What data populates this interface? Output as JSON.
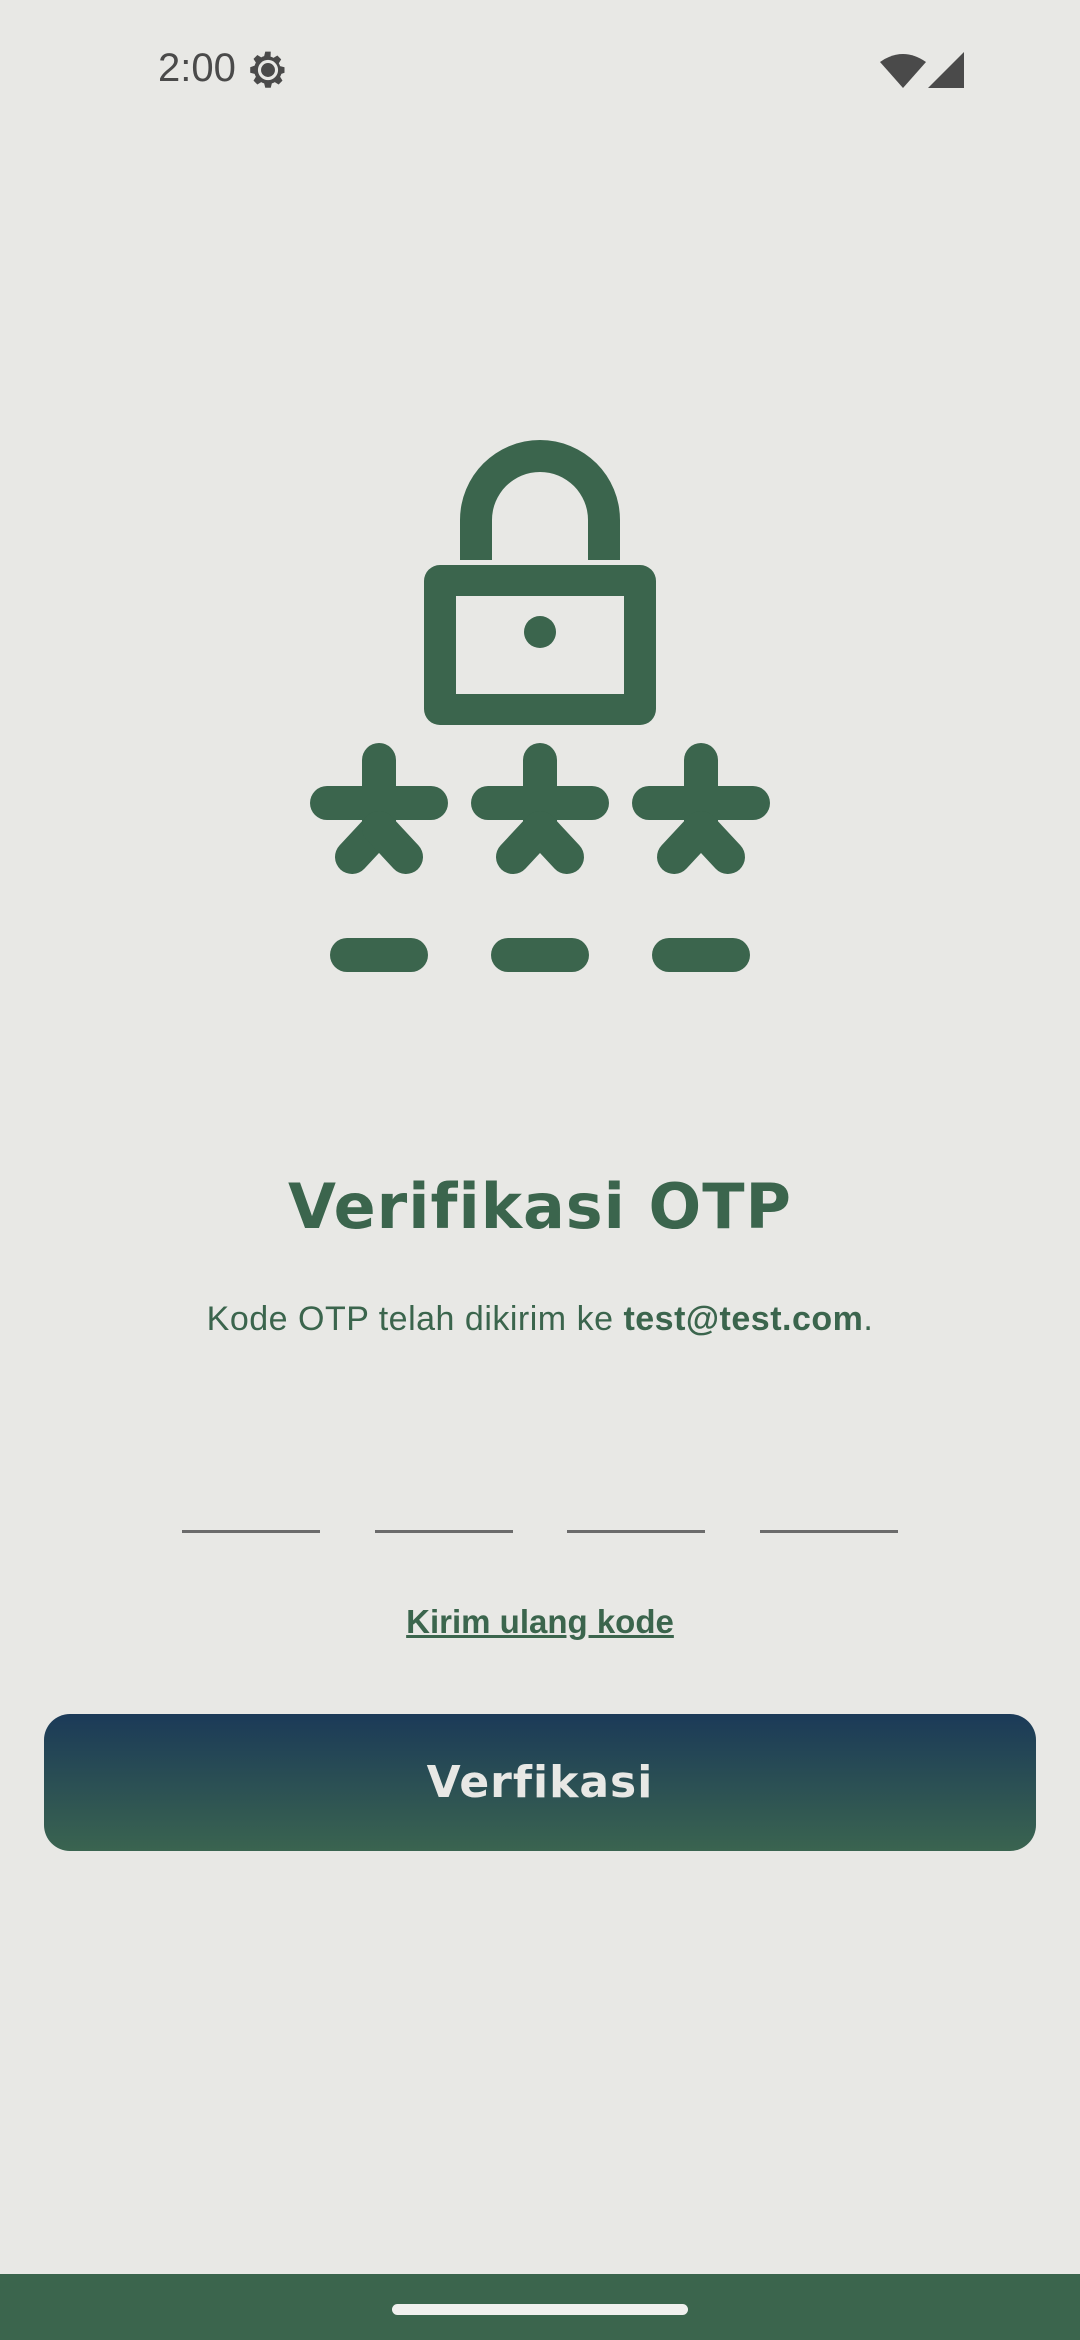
{
  "status_bar": {
    "time": "2:00",
    "settings_icon": "gear-icon",
    "wifi_icon": "wifi-icon",
    "signal_icon": "cell-signal-icon"
  },
  "hero": {
    "icon": "lock-password-icon"
  },
  "title": "Verifikasi OTP",
  "subtitle": {
    "prefix": "Kode OTP telah dikirim ke ",
    "email": "test@test.com",
    "suffix": "."
  },
  "otp": {
    "digits": [
      "",
      "",
      "",
      ""
    ]
  },
  "resend_label": "Kirim ulang kode",
  "verify_button_label": "Verfikasi",
  "colors": {
    "accent": "#3b654d",
    "background": "#e8e8e5",
    "button_gradient_top": "#1b3a58",
    "button_gradient_bottom": "#3a6450"
  }
}
